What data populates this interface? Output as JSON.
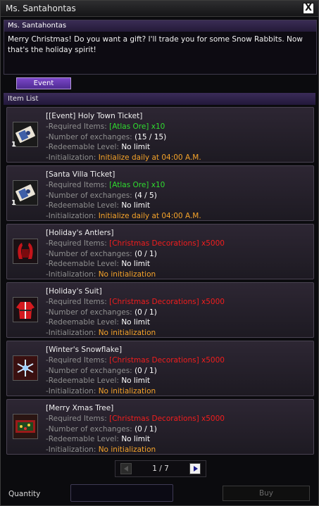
{
  "window": {
    "title": "Ms. Santahontas",
    "close_label": "X"
  },
  "npc": {
    "name": "Ms. Santahontas",
    "dialogue": "Merry Christmas! Do you want a gift? I'll trade you for some Snow Rabbits. Now that's the holiday spirit!"
  },
  "tab": {
    "label": "Event"
  },
  "list_header": "Item List",
  "labels": {
    "required": "-Required Items:",
    "exchanges": "-Number of exchanges:",
    "level": "-Redeemable Level:",
    "init": "-Initialization:"
  },
  "items": [
    {
      "name": "[[Event] Holy Town Ticket]",
      "qty": "1",
      "icon": "ticket-icon",
      "required": "[Atlas Ore] x10",
      "required_color": "green",
      "exchanges": "(15 / 15)",
      "level": "No limit",
      "init": "Initialize daily at 04:00 A.M.",
      "init_color": "orange"
    },
    {
      "name": "[Santa Villa Ticket]",
      "qty": "1",
      "icon": "ticket-icon",
      "required": "[Atlas Ore] x10",
      "required_color": "green",
      "exchanges": "(4 / 5)",
      "level": "No limit",
      "init": "Initialize daily at 04:00 A.M.",
      "init_color": "orange"
    },
    {
      "name": "[Holiday's Antlers]",
      "qty": "",
      "icon": "antlers-icon",
      "required": "[Christmas Decorations] x5000",
      "required_color": "red",
      "exchanges": "(0 / 1)",
      "level": "No limit",
      "init": "No initialization",
      "init_color": "orange"
    },
    {
      "name": "[Holiday's Suit]",
      "qty": "",
      "icon": "suit-icon",
      "required": "[Christmas Decorations] x5000",
      "required_color": "red",
      "exchanges": "(0 / 1)",
      "level": "No limit",
      "init": "No initialization",
      "init_color": "orange"
    },
    {
      "name": "[Winter's Snowflake]",
      "qty": "",
      "icon": "snowflake-icon",
      "required": "[Christmas Decorations] x5000",
      "required_color": "red",
      "exchanges": "(0 / 1)",
      "level": "No limit",
      "init": "No initialization",
      "init_color": "orange"
    },
    {
      "name": "[Merry Xmas Tree]",
      "qty": "",
      "icon": "xmas-tree-icon",
      "required": "[Christmas Decorations] x5000",
      "required_color": "red",
      "exchanges": "(0 / 1)",
      "level": "No limit",
      "init": "No initialization",
      "init_color": "orange"
    }
  ],
  "pager": {
    "text": "1 / 7"
  },
  "quantity": {
    "label": "Quantity",
    "value": ""
  },
  "buy": {
    "label": "Buy"
  }
}
